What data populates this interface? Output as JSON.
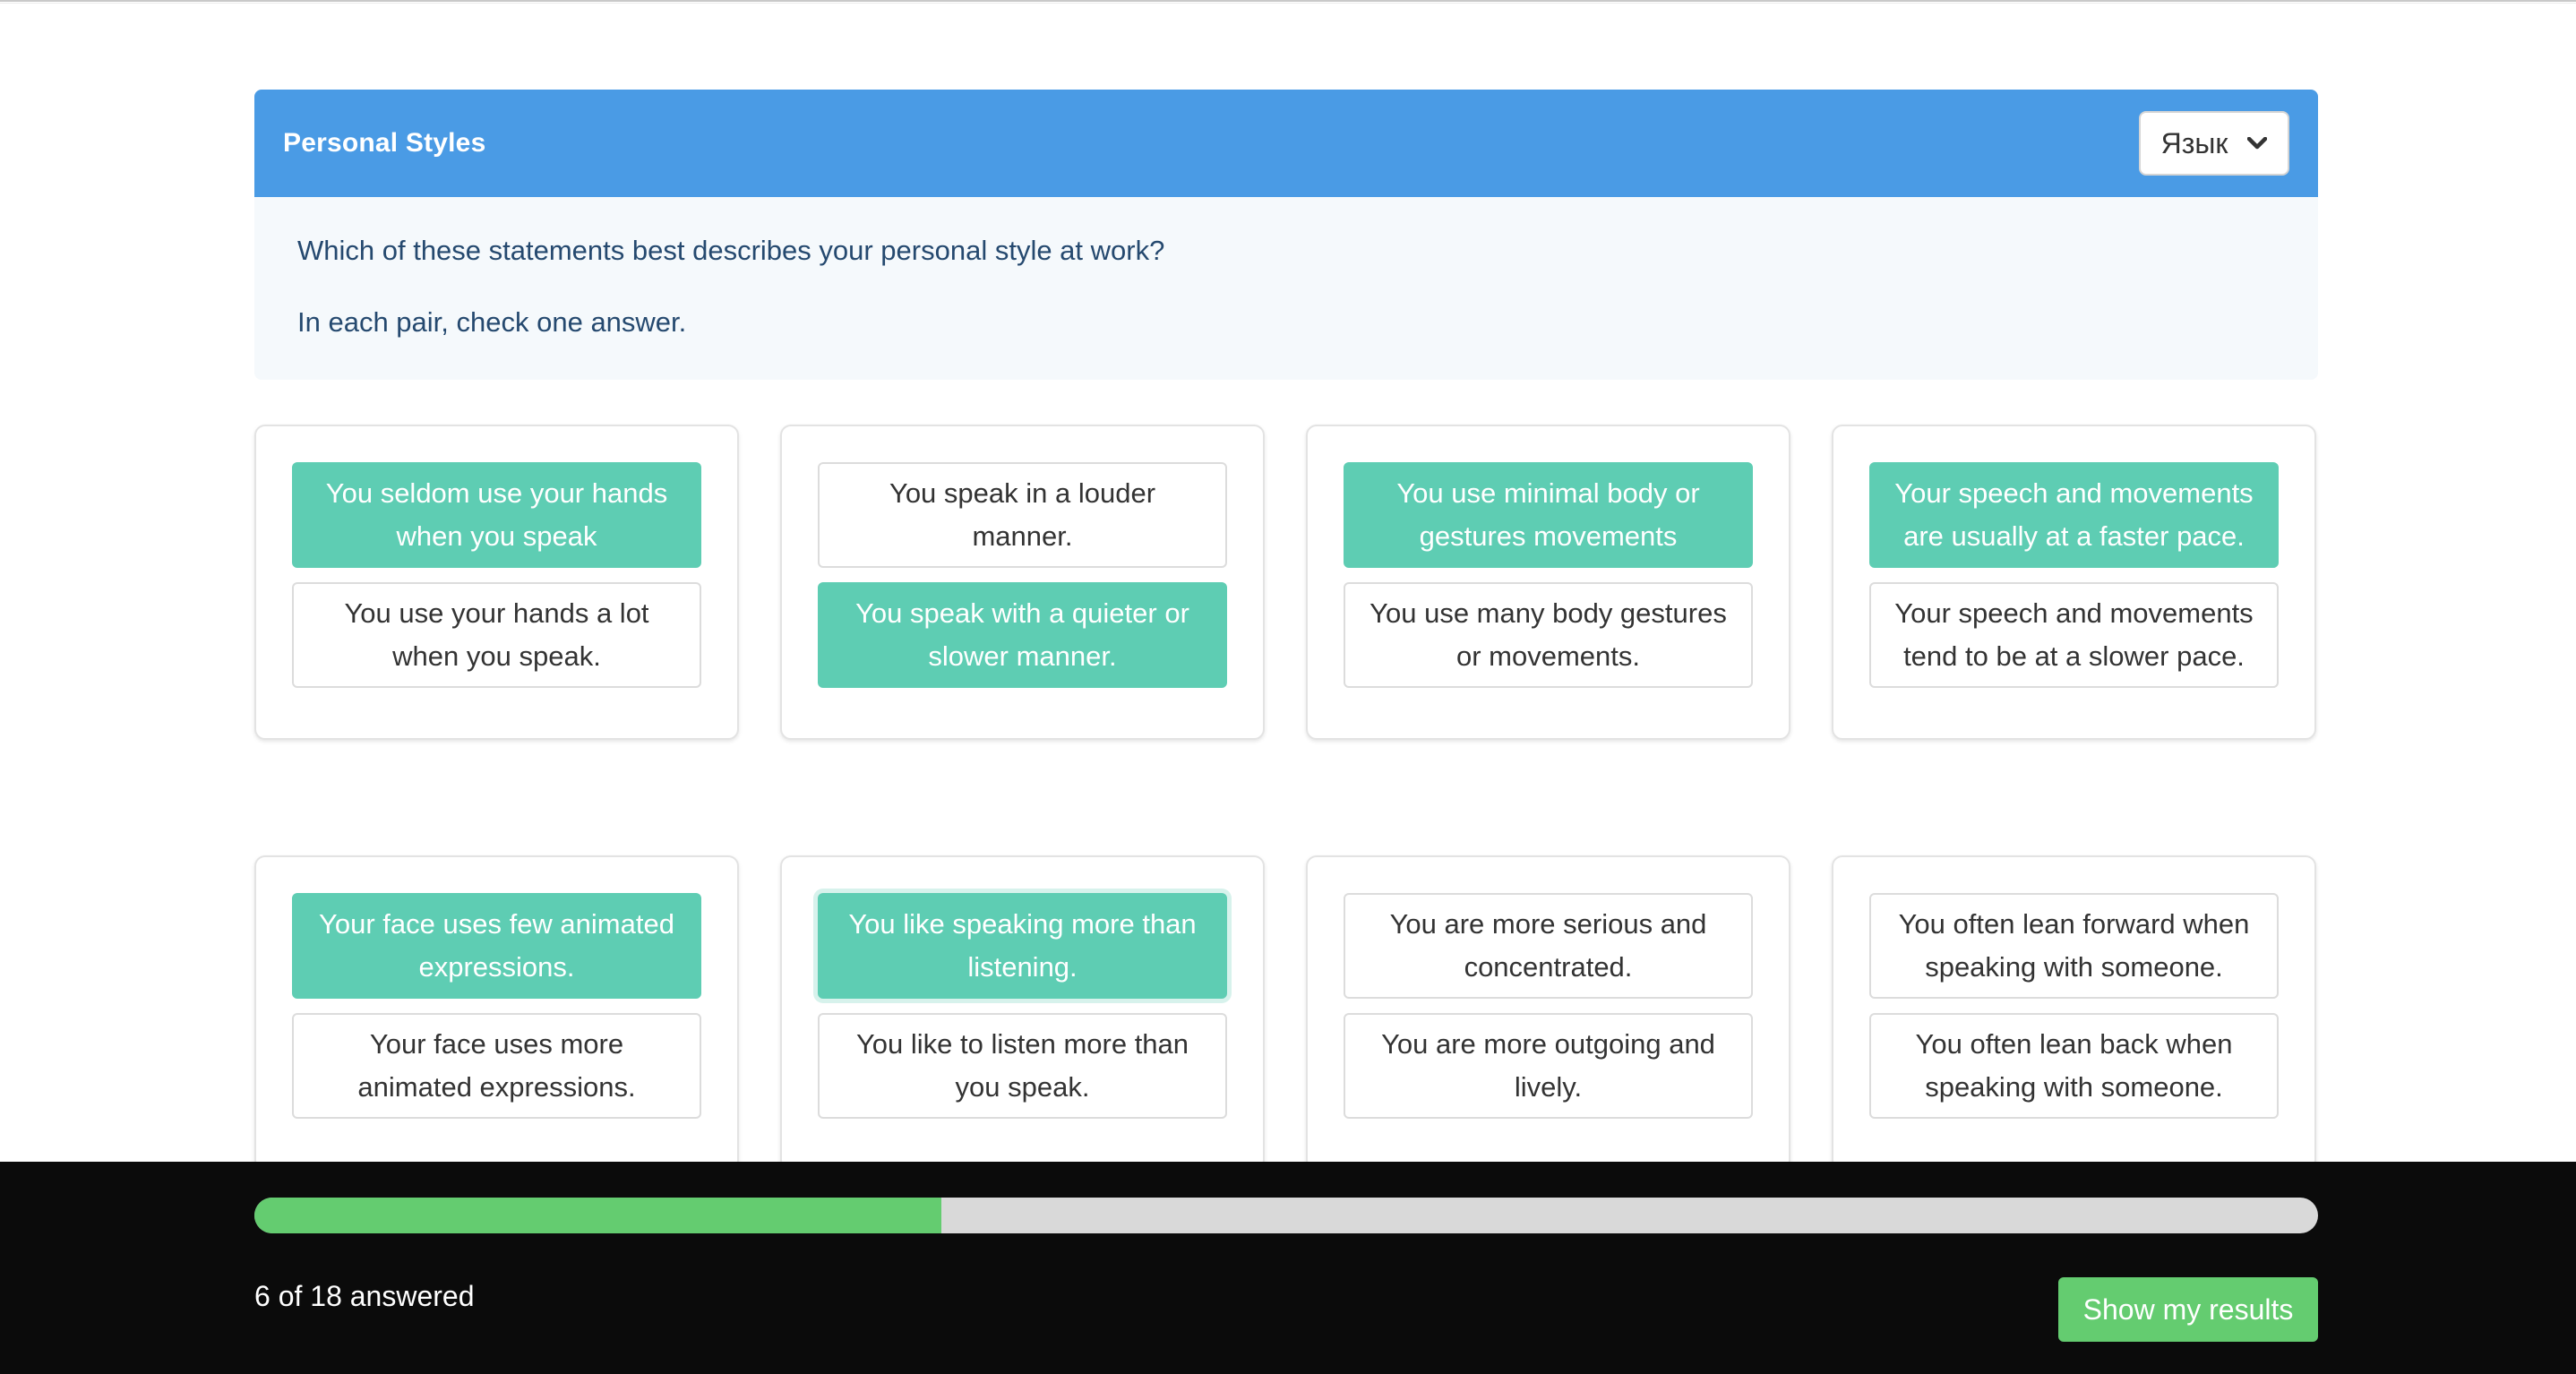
{
  "header": {
    "title": "Personal Styles",
    "language_select": {
      "label": "Язык",
      "icon": "chevron-down-icon"
    }
  },
  "instructions": {
    "question": "Which of these statements best describes your personal style at work?",
    "hint": "In each pair, check one answer."
  },
  "colors": {
    "header_bg": "#4a9be5",
    "selected_option": "#5ecdb3",
    "progress_fill": "#64cc70",
    "progress_track": "#d9d9d9",
    "footer_bg": "#0b0b0b"
  },
  "pairs": [
    {
      "options": [
        "You seldom use your hands when you speak",
        "You use your hands a lot when you speak."
      ],
      "selected": 0
    },
    {
      "options": [
        "You speak in a louder manner.",
        "You speak with a quieter or slower manner."
      ],
      "selected": 1
    },
    {
      "options": [
        "You use minimal body or gestures movements",
        "You use many body gestures or movements."
      ],
      "selected": 0
    },
    {
      "options": [
        "Your speech and movements are usually at a faster pace.",
        "Your speech and movements tend to be at a slower pace."
      ],
      "selected": 0
    },
    {
      "options": [
        "Your face uses few animated expressions.",
        "Your face uses more animated expressions."
      ],
      "selected": 0
    },
    {
      "options": [
        "You like speaking more than listening.",
        "You like to listen more than you speak."
      ],
      "selected": 0,
      "focused": 0
    },
    {
      "options": [
        "You are more serious and concentrated.",
        "You are more outgoing and lively."
      ],
      "selected": null
    },
    {
      "options": [
        "You often lean forward when speaking with someone.",
        "You often lean back when speaking with someone."
      ],
      "selected": null
    }
  ],
  "footer": {
    "answered": 6,
    "total": 18,
    "progress_fraction": 0.333,
    "answered_label": "6 of 18 answered",
    "results_button_label": "Show my results"
  }
}
